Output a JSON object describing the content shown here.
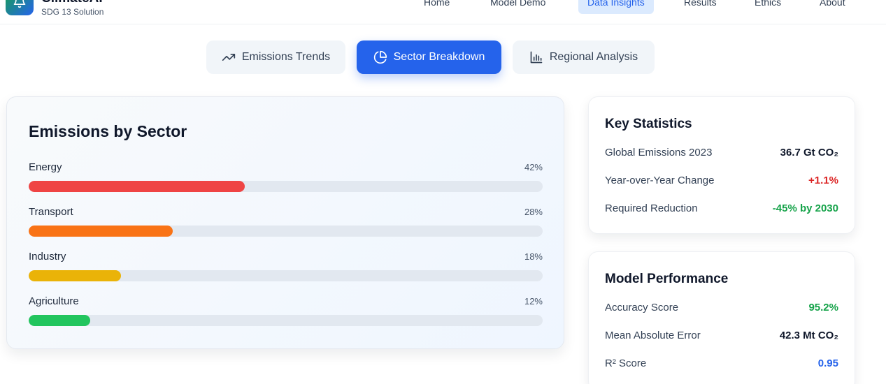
{
  "header": {
    "brand_name": "ClimateAI",
    "brand_sub": "SDG 13 Solution",
    "logo_icon": "bell-icon",
    "nav": [
      {
        "label": "Home",
        "active": false
      },
      {
        "label": "Model Demo",
        "active": false
      },
      {
        "label": "Data Insights",
        "active": true
      },
      {
        "label": "Results",
        "active": false
      },
      {
        "label": "Ethics",
        "active": false
      },
      {
        "label": "About",
        "active": false
      }
    ]
  },
  "tabs": [
    {
      "label": "Emissions Trends",
      "icon": "trending-up-icon",
      "active": false
    },
    {
      "label": "Sector Breakdown",
      "icon": "pie-chart-icon",
      "active": true
    },
    {
      "label": "Regional Analysis",
      "icon": "bar-chart-icon",
      "active": false
    }
  ],
  "sector_card": {
    "title": "Emissions by Sector",
    "sectors": [
      {
        "name": "Energy",
        "percent_label": "42%",
        "value": 42,
        "color": "#ef4444"
      },
      {
        "name": "Transport",
        "percent_label": "28%",
        "value": 28,
        "color": "#f97316"
      },
      {
        "name": "Industry",
        "percent_label": "18%",
        "value": 18,
        "color": "#eab308"
      },
      {
        "name": "Agriculture",
        "percent_label": "12%",
        "value": 12,
        "color": "#22c55e"
      }
    ]
  },
  "key_statistics": {
    "title": "Key Statistics",
    "rows": [
      {
        "label": "Global Emissions 2023",
        "value": "36.7 Gt CO₂",
        "color": "#0f172a"
      },
      {
        "label": "Year-over-Year Change",
        "value": "+1.1%",
        "color": "#dc2626"
      },
      {
        "label": "Required Reduction",
        "value": "-45% by 2030",
        "color": "#16a34a"
      }
    ]
  },
  "model_performance": {
    "title": "Model Performance",
    "rows": [
      {
        "label": "Accuracy Score",
        "value": "95.2%",
        "color": "#16a34a"
      },
      {
        "label": "Mean Absolute Error",
        "value": "42.3 Mt CO₂",
        "color": "#0f172a"
      },
      {
        "label": "R² Score",
        "value": "0.95",
        "color": "#2563eb"
      }
    ]
  },
  "colors": {
    "accent": "#2563eb",
    "accent_light": "#dbeafe"
  }
}
